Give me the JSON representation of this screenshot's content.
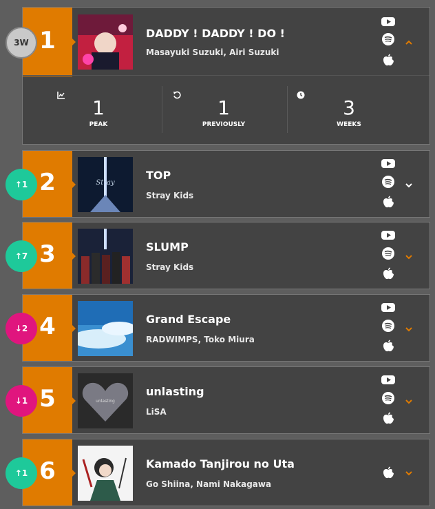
{
  "entries": [
    {
      "rank": "1",
      "title": "DADDY ! DADDY ! DO !",
      "artist": "Masayuki Suzuki, Airi Suzuki",
      "badge": "3W",
      "badge_type": "new",
      "expanded": true
    },
    {
      "rank": "2",
      "title": "TOP",
      "artist": "Stray Kids",
      "badge": "↑1",
      "badge_type": "up"
    },
    {
      "rank": "3",
      "title": "SLUMP",
      "artist": "Stray Kids",
      "badge": "↑7",
      "badge_type": "up"
    },
    {
      "rank": "4",
      "title": "Grand Escape",
      "artist": "RADWIMPS, Toko Miura",
      "badge": "↓2",
      "badge_type": "down"
    },
    {
      "rank": "5",
      "title": "unlasting",
      "artist": "LiSA",
      "badge": "↓1",
      "badge_type": "down"
    },
    {
      "rank": "6",
      "title": "Kamado Tanjirou no Uta",
      "artist": "Go Shiina, Nami Nakagawa",
      "badge": "↑1",
      "badge_type": "up"
    }
  ],
  "stats": [
    {
      "value": "1",
      "label": "PEAK",
      "icon": "chart-icon"
    },
    {
      "value": "1",
      "label": "PREVIOUSLY",
      "icon": "history-icon"
    },
    {
      "value": "3",
      "label": "WEEKS",
      "icon": "clock-icon"
    }
  ],
  "colors": {
    "rank_box": "#e07b00",
    "up": "#1ec99a",
    "down": "#e0157e",
    "chevron": "#e07b00"
  }
}
